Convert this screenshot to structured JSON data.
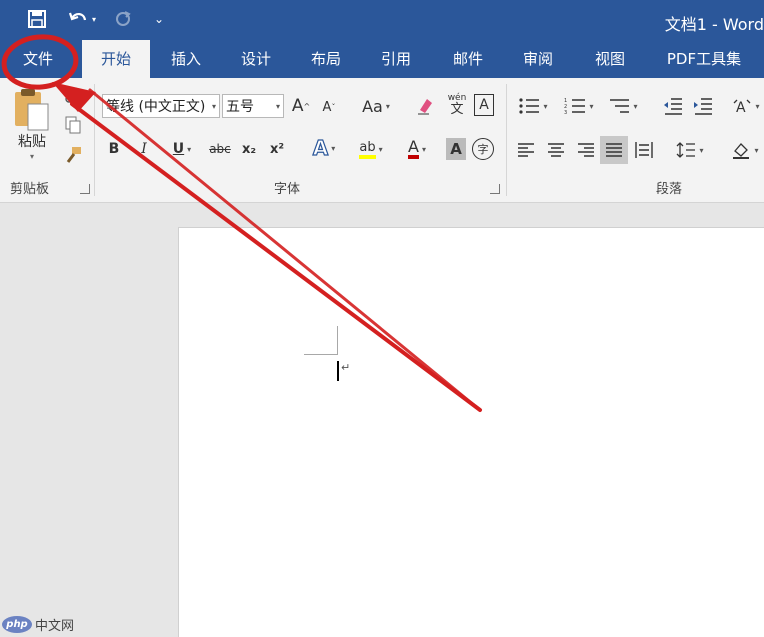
{
  "title_bar": {
    "title": "文档1 - Word",
    "qat": {
      "save_icon": "save-icon",
      "undo_icon": "undo-icon",
      "redo_icon": "redo-icon",
      "customize_icon": "customize-qat-icon"
    }
  },
  "tabs": [
    "文件",
    "开始",
    "插入",
    "设计",
    "布局",
    "引用",
    "邮件",
    "审阅",
    "视图",
    "PDF工具集"
  ],
  "active_tab": "开始",
  "ribbon": {
    "clipboard": {
      "label": "剪贴板",
      "paste_label": "粘贴"
    },
    "font": {
      "label": "字体",
      "font_name": "等线 (中文正文)",
      "font_size": "五号",
      "grow": "A",
      "shrink": "A",
      "change_case": "Aa",
      "phonetic_top": "wén",
      "phonetic_bottom": "文",
      "border_char": "A",
      "bold": "B",
      "italic": "I",
      "underline": "U",
      "strike": "abc",
      "subscript": "x₂",
      "superscript": "x²",
      "effects": "A",
      "highlight": "ab",
      "font_color": "A",
      "shading": "A",
      "enclose": "字"
    },
    "paragraph": {
      "label": "段落"
    }
  },
  "watermark": {
    "logo": "php",
    "text": "中文网"
  },
  "colors": {
    "accent": "#2b579a",
    "annotation": "#d42020"
  }
}
